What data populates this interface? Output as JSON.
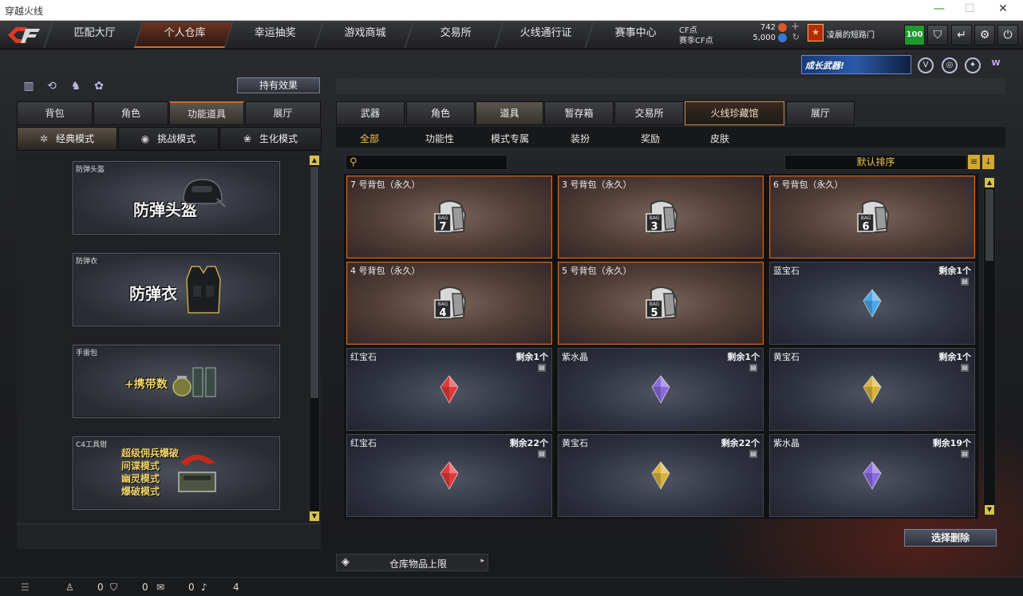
{
  "window": {
    "title": "穿越火线"
  },
  "nav": {
    "tabs": [
      "匹配大厅",
      "个人仓库",
      "幸运抽奖",
      "游戏商城",
      "交易所",
      "火线通行证",
      "赛事中心"
    ],
    "active_index": 1
  },
  "currency": {
    "cf_label": "CF点",
    "cf_value": "742",
    "season_label": "赛季CF点",
    "season_value": "5,000"
  },
  "profile": {
    "name": "凌晨的短路门",
    "level_badge": "100"
  },
  "promo": {
    "text": "成长武器!"
  },
  "left": {
    "effect_button": "持有效果",
    "tabs": [
      "背包",
      "角色",
      "功能道具",
      "展厅"
    ],
    "active_tab": 2,
    "modes": [
      "经典模式",
      "挑战模式",
      "生化模式"
    ],
    "active_mode": 0,
    "cards": [
      {
        "caption": "防弹头盔",
        "big": "防弹头盔"
      },
      {
        "caption": "防弹衣",
        "big": "防弹衣"
      },
      {
        "caption": "手雷包",
        "big": "+携带数"
      },
      {
        "caption": "C4工具钳",
        "lines": [
          "超级佣兵爆破",
          "间谍模式",
          "幽灵模式",
          "爆破模式"
        ]
      }
    ]
  },
  "right": {
    "tabs": [
      "武器",
      "角色",
      "道具",
      "暂存箱",
      "交易所",
      "火线珍藏馆",
      "展厅"
    ],
    "active_tab": 2,
    "sub_tabs": [
      "全部",
      "功能性",
      "模式专属",
      "装扮",
      "奖励",
      "皮肤"
    ],
    "active_sub": 0,
    "sort_label": "默认排序",
    "items": [
      {
        "name": "7 号背包（永久）",
        "type": "bag",
        "bag_no": "7"
      },
      {
        "name": "3 号背包（永久）",
        "type": "bag",
        "bag_no": "3"
      },
      {
        "name": "6 号背包（永久）",
        "type": "bag",
        "bag_no": "6"
      },
      {
        "name": "4 号背包（永久）",
        "type": "bag",
        "bag_no": "4"
      },
      {
        "name": "5 号背包（永久）",
        "type": "bag",
        "bag_no": "5"
      },
      {
        "name": "蓝宝石",
        "type": "gem",
        "qty": "剩余1个",
        "color": "#4aa6e8"
      },
      {
        "name": "红宝石",
        "type": "gem",
        "qty": "剩余1个",
        "color": "#e23a3a"
      },
      {
        "name": "紫水晶",
        "type": "gem",
        "qty": "剩余1个",
        "color": "#8a6ae0"
      },
      {
        "name": "黄宝石",
        "type": "gem",
        "qty": "剩余1个",
        "color": "#d8b43a"
      },
      {
        "name": "红宝石",
        "type": "gem",
        "qty": "剩余22个",
        "color": "#e23a3a"
      },
      {
        "name": "黄宝石",
        "type": "gem",
        "qty": "剩余22个",
        "color": "#d8b43a"
      },
      {
        "name": "紫水晶",
        "type": "gem",
        "qty": "剩余19个",
        "color": "#8a6ae0"
      }
    ],
    "delete_button": "选择删除",
    "limit_label": "仓库物品上限"
  },
  "status": {
    "a": "0",
    "b": "0",
    "c": "0",
    "d": "4"
  }
}
